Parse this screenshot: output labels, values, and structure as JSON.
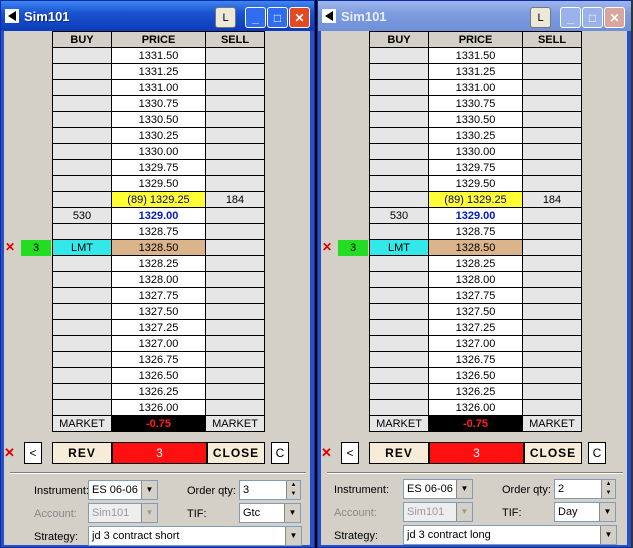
{
  "windows": [
    {
      "title": "Sim101",
      "l_btn": "L",
      "headers": {
        "buy": "BUY",
        "price": "PRICE",
        "sell": "SELL"
      },
      "rows": [
        {
          "buy": "",
          "price": "1331.50",
          "sell": ""
        },
        {
          "buy": "",
          "price": "1331.25",
          "sell": ""
        },
        {
          "buy": "",
          "price": "1331.00",
          "sell": ""
        },
        {
          "buy": "",
          "price": "1330.75",
          "sell": ""
        },
        {
          "buy": "",
          "price": "1330.50",
          "sell": ""
        },
        {
          "buy": "",
          "price": "1330.25",
          "sell": ""
        },
        {
          "buy": "",
          "price": "1330.00",
          "sell": ""
        },
        {
          "buy": "",
          "price": "1329.75",
          "sell": ""
        },
        {
          "buy": "",
          "price": "1329.50",
          "sell": ""
        },
        {
          "buy": "",
          "price": "(89) 1329.25",
          "sell": "184"
        },
        {
          "buy": "530",
          "price": "1329.00",
          "sell": ""
        },
        {
          "buy": "",
          "price": "1328.75",
          "sell": ""
        },
        {
          "buy": "LMT",
          "price": "1328.50",
          "sell": ""
        },
        {
          "buy": "",
          "price": "1328.25",
          "sell": ""
        },
        {
          "buy": "",
          "price": "1328.00",
          "sell": ""
        },
        {
          "buy": "",
          "price": "1327.75",
          "sell": ""
        },
        {
          "buy": "",
          "price": "1327.50",
          "sell": ""
        },
        {
          "buy": "",
          "price": "1327.25",
          "sell": ""
        },
        {
          "buy": "",
          "price": "1327.00",
          "sell": ""
        },
        {
          "buy": "",
          "price": "1326.75",
          "sell": ""
        },
        {
          "buy": "",
          "price": "1326.50",
          "sell": ""
        },
        {
          "buy": "",
          "price": "1326.25",
          "sell": ""
        },
        {
          "buy": "",
          "price": "1326.00",
          "sell": ""
        }
      ],
      "market_buy": "MARKET",
      "pnl": "-0.75",
      "market_sell": "MARKET",
      "order_marker_x": "✕",
      "order_qty_marker": "3",
      "controls": {
        "x": "✕",
        "left": "<",
        "rev": "REV",
        "position": "3",
        "close": "CLOSE",
        "c": "C"
      },
      "instrument_label": "Instrument:",
      "instrument": "ES 06-06",
      "account_label": "Account:",
      "account": "Sim101",
      "strategy_label": "Strategy:",
      "strategy": "jd 3 contract short",
      "orderqty_label": "Order qty:",
      "orderqty": "3",
      "tif_label": "TIF:",
      "tif": "Gtc"
    },
    {
      "title": "Sim101",
      "l_btn": "L",
      "headers": {
        "buy": "BUY",
        "price": "PRICE",
        "sell": "SELL"
      },
      "rows": [
        {
          "buy": "",
          "price": "1331.50",
          "sell": ""
        },
        {
          "buy": "",
          "price": "1331.25",
          "sell": ""
        },
        {
          "buy": "",
          "price": "1331.00",
          "sell": ""
        },
        {
          "buy": "",
          "price": "1330.75",
          "sell": ""
        },
        {
          "buy": "",
          "price": "1330.50",
          "sell": ""
        },
        {
          "buy": "",
          "price": "1330.25",
          "sell": ""
        },
        {
          "buy": "",
          "price": "1330.00",
          "sell": ""
        },
        {
          "buy": "",
          "price": "1329.75",
          "sell": ""
        },
        {
          "buy": "",
          "price": "1329.50",
          "sell": ""
        },
        {
          "buy": "",
          "price": "(89) 1329.25",
          "sell": "184"
        },
        {
          "buy": "530",
          "price": "1329.00",
          "sell": ""
        },
        {
          "buy": "",
          "price": "1328.75",
          "sell": ""
        },
        {
          "buy": "LMT",
          "price": "1328.50",
          "sell": ""
        },
        {
          "buy": "",
          "price": "1328.25",
          "sell": ""
        },
        {
          "buy": "",
          "price": "1328.00",
          "sell": ""
        },
        {
          "buy": "",
          "price": "1327.75",
          "sell": ""
        },
        {
          "buy": "",
          "price": "1327.50",
          "sell": ""
        },
        {
          "buy": "",
          "price": "1327.25",
          "sell": ""
        },
        {
          "buy": "",
          "price": "1327.00",
          "sell": ""
        },
        {
          "buy": "",
          "price": "1326.75",
          "sell": ""
        },
        {
          "buy": "",
          "price": "1326.50",
          "sell": ""
        },
        {
          "buy": "",
          "price": "1326.25",
          "sell": ""
        },
        {
          "buy": "",
          "price": "1326.00",
          "sell": ""
        }
      ],
      "market_buy": "MARKET",
      "pnl": "-0.75",
      "market_sell": "MARKET",
      "order_marker_x": "✕",
      "order_qty_marker": "3",
      "controls": {
        "x": "✕",
        "left": "<",
        "rev": "REV",
        "position": "3",
        "close": "CLOSE",
        "c": "C"
      },
      "instrument_label": "Instrument:",
      "instrument": "ES 06-06",
      "account_label": "Account:",
      "account": "Sim101",
      "strategy_label": "Strategy:",
      "strategy": "jd 3 contract long",
      "orderqty_label": "Order qty:",
      "orderqty": "2",
      "tif_label": "TIF:",
      "tif": "Day"
    }
  ],
  "colors": {
    "ask": "#ffff33",
    "limit_order": "#33e8e8",
    "limit_price": "#dcb48c",
    "position": "#ff1010",
    "pnl": "#ff2020"
  }
}
